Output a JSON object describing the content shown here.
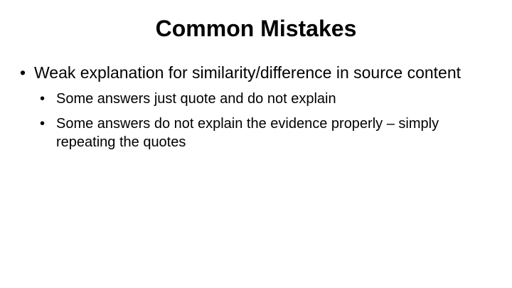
{
  "slide": {
    "title": "Common Mistakes",
    "bullet_glyph": "•",
    "points": [
      {
        "text": "Weak explanation for similarity/difference in source content",
        "subpoints": [
          "Some answers just quote and do not explain",
          "Some answers do not explain the evidence properly – simply repeating the quotes"
        ]
      }
    ]
  }
}
